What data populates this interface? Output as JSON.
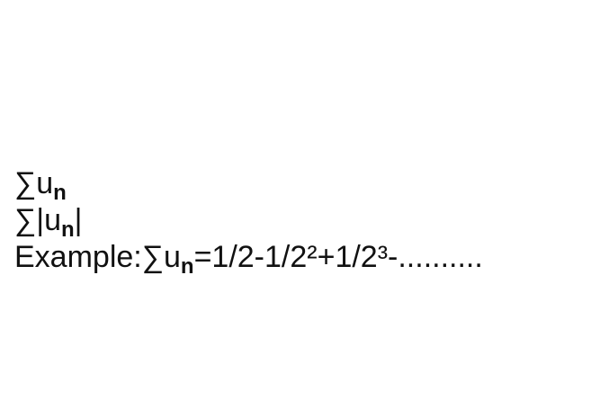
{
  "lines": {
    "line1": {
      "sigma": "∑",
      "u": "u",
      "sub": "n"
    },
    "line2": {
      "sigma": "∑|",
      "u": "u",
      "sub": "n",
      "close": "|"
    },
    "line3": {
      "prefix": "Example:∑",
      "u": "u",
      "sub": "n",
      "rest": "=1/2-1/2²+1/2³-.........."
    }
  }
}
